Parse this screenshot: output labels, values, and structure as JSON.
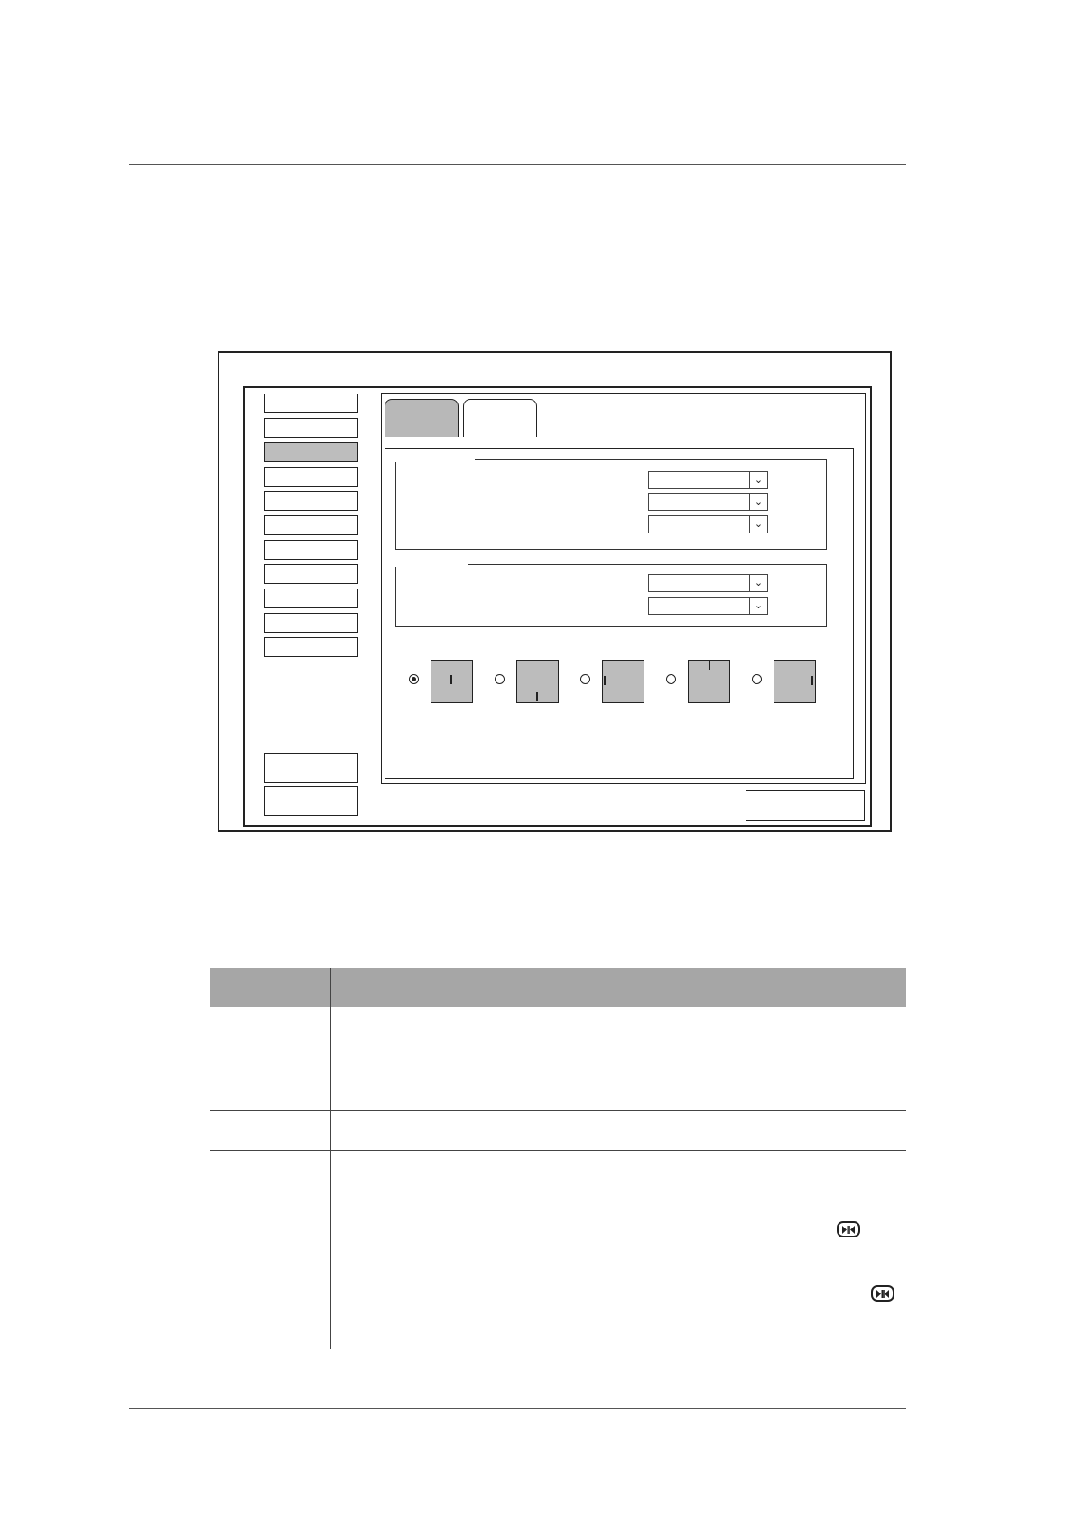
{
  "figure": {
    "menu_items": [
      "",
      "",
      "",
      "",
      "",
      "",
      "",
      "",
      "",
      "",
      ""
    ],
    "active_menu_index": 2,
    "side_buttons": [
      "",
      ""
    ],
    "tabs": [
      "",
      ""
    ],
    "active_tab_index": 0,
    "group1_selects": [
      "",
      "",
      ""
    ],
    "group2_selects": [
      "",
      ""
    ],
    "orientation_options": [
      {
        "mark": "center",
        "checked": true
      },
      {
        "mark": "bottom",
        "checked": false
      },
      {
        "mark": "left",
        "checked": false
      },
      {
        "mark": "top",
        "checked": false
      },
      {
        "mark": "right",
        "checked": false
      }
    ],
    "ok_button": "",
    "colors": {
      "active": "#bdbdbd",
      "tab_active": "#b8b8b8",
      "header": "#a6a6a6",
      "line": "#222222"
    }
  },
  "table": {
    "headers": [
      "",
      ""
    ],
    "rows": [
      {
        "label": "",
        "text": ""
      },
      {
        "label": "",
        "text": ""
      },
      {
        "label": "",
        "text": ""
      }
    ],
    "icon_name": "freeze-button-icon"
  }
}
